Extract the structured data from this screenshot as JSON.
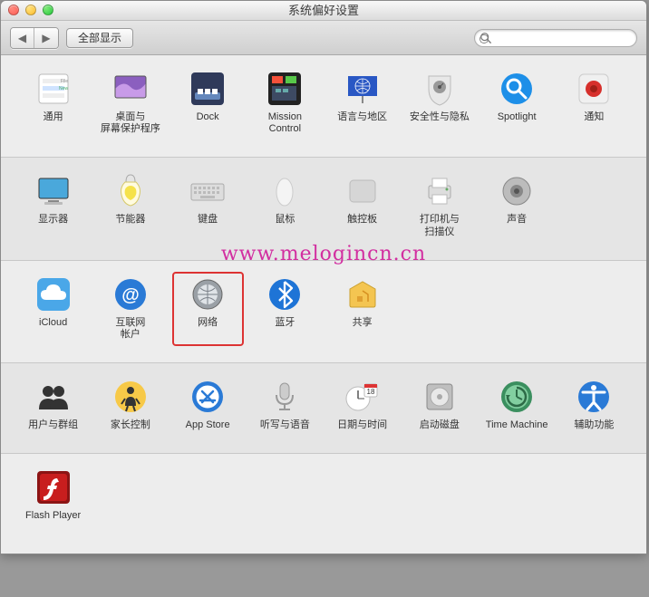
{
  "window": {
    "title": "系统偏好设置"
  },
  "toolbar": {
    "back_glyph": "◀",
    "fwd_glyph": "▶",
    "show_all": "全部显示",
    "search_placeholder": ""
  },
  "watermark": "www.melogincn.cn",
  "rows": [
    [
      {
        "id": "general",
        "label": "通用"
      },
      {
        "id": "desktop",
        "label": "桌面与\n屏幕保护程序"
      },
      {
        "id": "dock",
        "label": "Dock"
      },
      {
        "id": "mission",
        "label": "Mission\nControl"
      },
      {
        "id": "language",
        "label": "语言与地区"
      },
      {
        "id": "security",
        "label": "安全性与隐私"
      },
      {
        "id": "spotlight",
        "label": "Spotlight"
      },
      {
        "id": "notifications",
        "label": "通知"
      }
    ],
    [
      {
        "id": "displays",
        "label": "显示器"
      },
      {
        "id": "energy",
        "label": "节能器"
      },
      {
        "id": "keyboard",
        "label": "键盘"
      },
      {
        "id": "mouse",
        "label": "鼠标"
      },
      {
        "id": "trackpad",
        "label": "触控板"
      },
      {
        "id": "printers",
        "label": "打印机与\n扫描仪"
      },
      {
        "id": "sound",
        "label": "声音"
      }
    ],
    [
      {
        "id": "icloud",
        "label": "iCloud"
      },
      {
        "id": "internet",
        "label": "互联网\n帐户"
      },
      {
        "id": "network",
        "label": "网络",
        "highlight": true
      },
      {
        "id": "bluetooth",
        "label": "蓝牙"
      },
      {
        "id": "sharing",
        "label": "共享"
      }
    ],
    [
      {
        "id": "users",
        "label": "用户与群组"
      },
      {
        "id": "parental",
        "label": "家长控制"
      },
      {
        "id": "appstore",
        "label": "App Store"
      },
      {
        "id": "dictation",
        "label": "听写与语音"
      },
      {
        "id": "datetime",
        "label": "日期与时间"
      },
      {
        "id": "startupdisk",
        "label": "启动磁盘"
      },
      {
        "id": "timemachine",
        "label": "Time Machine"
      },
      {
        "id": "accessibility",
        "label": "辅助功能"
      }
    ],
    [
      {
        "id": "flash",
        "label": "Flash Player"
      }
    ]
  ]
}
